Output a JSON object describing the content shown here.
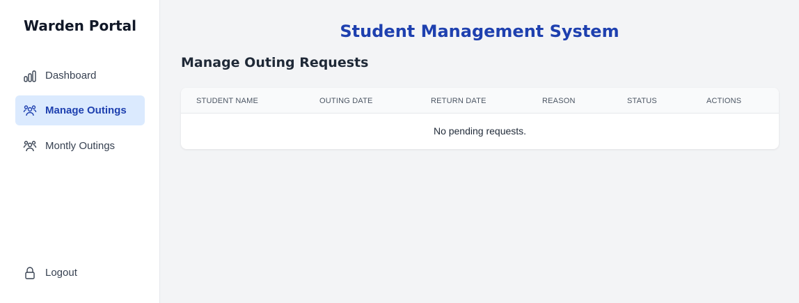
{
  "sidebar": {
    "brand": "Warden Portal",
    "items": [
      {
        "label": "Dashboard",
        "icon": "bar-chart-icon",
        "active": false
      },
      {
        "label": "Manage Outings",
        "icon": "users-icon",
        "active": true
      },
      {
        "label": "Montly Outings",
        "icon": "users-icon",
        "active": false
      }
    ],
    "logout": {
      "label": "Logout",
      "icon": "lock-icon"
    }
  },
  "header": {
    "title": "Student Management System"
  },
  "main": {
    "section_title": "Manage Outing Requests",
    "table": {
      "columns": [
        "STUDENT NAME",
        "OUTING DATE",
        "RETURN DATE",
        "REASON",
        "STATUS",
        "ACTIONS"
      ],
      "empty_message": "No pending requests."
    }
  },
  "colors": {
    "accent": "#1e40af",
    "active_bg": "#dbeafe",
    "page_bg": "#f3f4f6"
  }
}
